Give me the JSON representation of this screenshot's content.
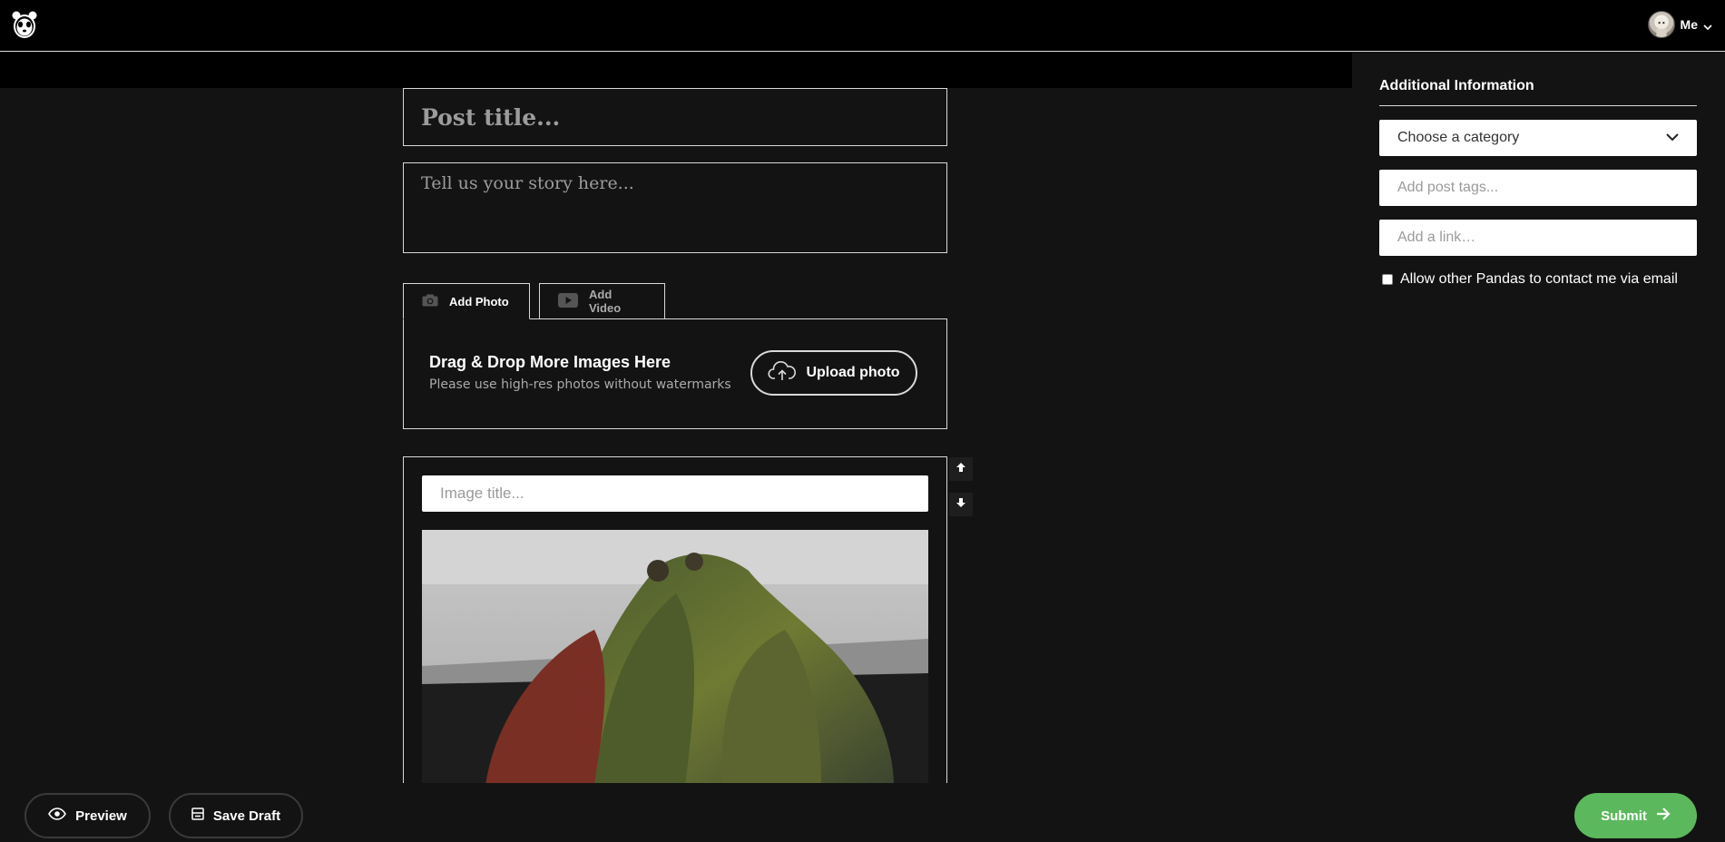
{
  "header": {
    "logo": "panda-logo-icon",
    "user_label": "Me"
  },
  "editor": {
    "title_placeholder": "Post title...",
    "story_placeholder": "Tell us your story here...",
    "tabs": [
      {
        "label": "Add Photo",
        "icon": "camera-icon",
        "active": true
      },
      {
        "label": "Add Video",
        "icon": "video-play-icon",
        "active": false
      }
    ],
    "upload": {
      "title": "Drag & Drop More Images Here",
      "subtitle": "Please use high-res photos without watermarks",
      "button_label": "Upload photo"
    },
    "image_card": {
      "title_placeholder": "Image title..."
    }
  },
  "sidebar": {
    "title": "Additional Information",
    "category_placeholder": "Choose a category",
    "tags_placeholder": "Add post tags...",
    "link_placeholder": "Add a link…",
    "contact_checkbox_label": "Allow other Pandas to contact me via email"
  },
  "footer": {
    "preview_label": "Preview",
    "draft_label": "Save Draft",
    "submit_label": "Submit"
  },
  "colors": {
    "background": "#131313",
    "header": "#000000",
    "submit_green": "#5cb85c"
  }
}
